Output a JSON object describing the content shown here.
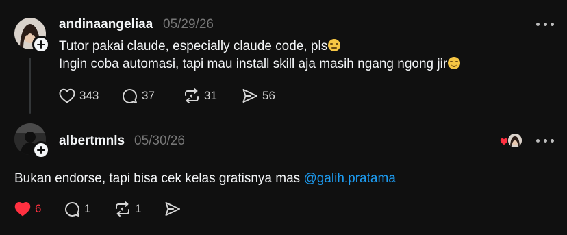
{
  "posts": [
    {
      "username": "andinaangeliaa",
      "date": "05/29/26",
      "lines": [
        "Tutor pakai claude, especially claude code, pls",
        "Ingin coba automasi, tapi mau install skill aja masih ngang ngong jir"
      ],
      "emojis": [
        "pensive-face-emoji",
        "slightly-smiling-face-emoji"
      ],
      "actions": {
        "likes": "343",
        "comments": "37",
        "reposts": "31",
        "shares": "56"
      },
      "liked": false
    },
    {
      "username": "albertmnls",
      "date": "05/30/26",
      "text": "Bukan endorse, tapi bisa cek kelas gratisnya mas ",
      "mention": "@galih.pratama",
      "actions": {
        "likes": "6",
        "comments": "1",
        "reposts": "1"
      },
      "liked": true
    }
  ],
  "colors": {
    "background": "#101010",
    "text": "#f3f5f7",
    "muted": "#777777",
    "like_red": "#ff3040",
    "mention_blue": "#1d9bf0"
  },
  "icons": [
    "heart-icon",
    "comment-icon",
    "repost-icon",
    "share-icon",
    "more-icon",
    "plus-icon"
  ]
}
